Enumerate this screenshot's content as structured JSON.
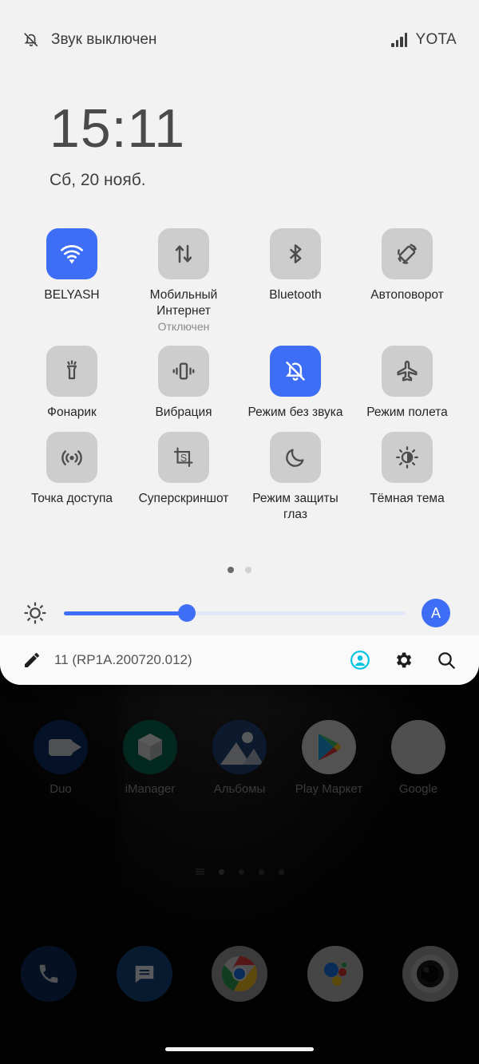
{
  "statusbar": {
    "mute_icon": "bell-off-icon",
    "mute_text": "Звук выключен",
    "signal_icon": "signal-bars-icon",
    "carrier": "YOTA"
  },
  "clock": {
    "time": "15:11",
    "date": "Сб, 20 нояб."
  },
  "tiles": [
    {
      "label": "BELYASH",
      "sub": "",
      "icon": "wifi-icon",
      "active": true
    },
    {
      "label": "Мобильный Интернет",
      "sub": "Отключен",
      "icon": "mobile-data-icon",
      "active": false
    },
    {
      "label": "Bluetooth",
      "sub": "",
      "icon": "bluetooth-icon",
      "active": false
    },
    {
      "label": "Автоповорот",
      "sub": "",
      "icon": "auto-rotate-icon",
      "active": false
    },
    {
      "label": "Фонарик",
      "sub": "",
      "icon": "flashlight-icon",
      "active": false
    },
    {
      "label": "Вибрация",
      "sub": "",
      "icon": "vibration-icon",
      "active": false
    },
    {
      "label": "Режим без звука",
      "sub": "",
      "icon": "bell-off-icon",
      "active": true
    },
    {
      "label": "Режим полета",
      "sub": "",
      "icon": "airplane-icon",
      "active": false
    },
    {
      "label": "Точка доступа",
      "sub": "",
      "icon": "hotspot-icon",
      "active": false
    },
    {
      "label": "Суперскриншот",
      "sub": "",
      "icon": "superscreenshot-icon",
      "active": false
    },
    {
      "label": "Режим защиты глаз",
      "sub": "",
      "icon": "moon-icon",
      "active": false
    },
    {
      "label": "Тёмная тема",
      "sub": "",
      "icon": "dark-theme-icon",
      "active": false
    }
  ],
  "tile_pager": {
    "pages": 2,
    "active_index": 0
  },
  "brightness": {
    "icon": "brightness-icon",
    "value_percent": 36,
    "auto_label": "A"
  },
  "footer": {
    "edit_icon": "pencil-icon",
    "build": "11 (RP1A.200720.012)",
    "user_icon": "account-icon",
    "settings_icon": "gear-icon",
    "search_icon": "search-icon"
  },
  "home": {
    "apps": [
      {
        "label": "Duo",
        "icon": "duo-icon"
      },
      {
        "label": "iManager",
        "icon": "imanager-icon"
      },
      {
        "label": "Альбомы",
        "icon": "albums-icon"
      },
      {
        "label": "Play Маркет",
        "icon": "play-store-icon"
      },
      {
        "label": "Google",
        "icon": "google-folder-icon"
      }
    ],
    "dock": [
      {
        "label": "",
        "icon": "phone-icon"
      },
      {
        "label": "",
        "icon": "messages-icon"
      },
      {
        "label": "",
        "icon": "chrome-icon"
      },
      {
        "label": "",
        "icon": "assistant-icon"
      },
      {
        "label": "",
        "icon": "camera-icon"
      }
    ],
    "page_dots": {
      "count": 4,
      "active_index": 1
    }
  },
  "colors": {
    "accent_blue": "#3d6ef5",
    "tile_inactive": "#cdcdcd",
    "shade_bg": "#f2f2f2",
    "avatar_cyan": "#00c3e3"
  }
}
